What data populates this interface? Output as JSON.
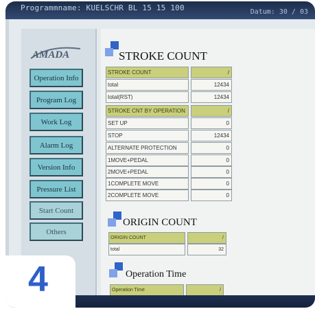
{
  "header": {
    "program_name": "Programmname: KUELSCHR BL 15 15 100",
    "datum": "Datum: 30 / 03"
  },
  "logo": {
    "text": "AMADA"
  },
  "sidebar": {
    "items": [
      {
        "label": "Operation Info"
      },
      {
        "label": "Program Log"
      },
      {
        "label": "Work Log"
      },
      {
        "label": "Alarm Log"
      },
      {
        "label": "Version Info"
      },
      {
        "label": "Pressure List"
      },
      {
        "label": "Start Count"
      },
      {
        "label": "Others"
      }
    ]
  },
  "stroke_count": {
    "title": "STROKE COUNT",
    "header": {
      "label": "STROKE COUNT",
      "value": "/"
    },
    "rows": [
      {
        "label": "total",
        "value": "12434"
      },
      {
        "label": "total(RST)",
        "value": "12434"
      }
    ],
    "op_header": {
      "label": "STROKE CNT BY OPERATION",
      "value": "/"
    },
    "op_rows": [
      {
        "label": "SET UP",
        "value": "0"
      },
      {
        "label": "STOP",
        "value": "12434"
      },
      {
        "label": "ALTERNATE PROTECTION",
        "value": "0"
      },
      {
        "label": "1MOVE+PEDAL",
        "value": "0"
      },
      {
        "label": "2MOVE+PEDAL",
        "value": "0"
      },
      {
        "label": "1COMPLETE MOVE",
        "value": "0"
      },
      {
        "label": "2COMPLETE MOVE",
        "value": "0"
      }
    ]
  },
  "origin_count": {
    "title": "ORIGIN COUNT",
    "header": {
      "label": "ORIGIN COUNT",
      "value": "/"
    },
    "rows": [
      {
        "label": "total",
        "value": "32"
      }
    ]
  },
  "operation_time": {
    "title": "Operation Time",
    "header": {
      "label": "Operation Time",
      "value": "/"
    }
  },
  "step": {
    "number": "4"
  },
  "colors": {
    "accent_blue": "#2e60c9",
    "nav_button": "#7fc5d0",
    "header_row": "#c9cf7a"
  }
}
